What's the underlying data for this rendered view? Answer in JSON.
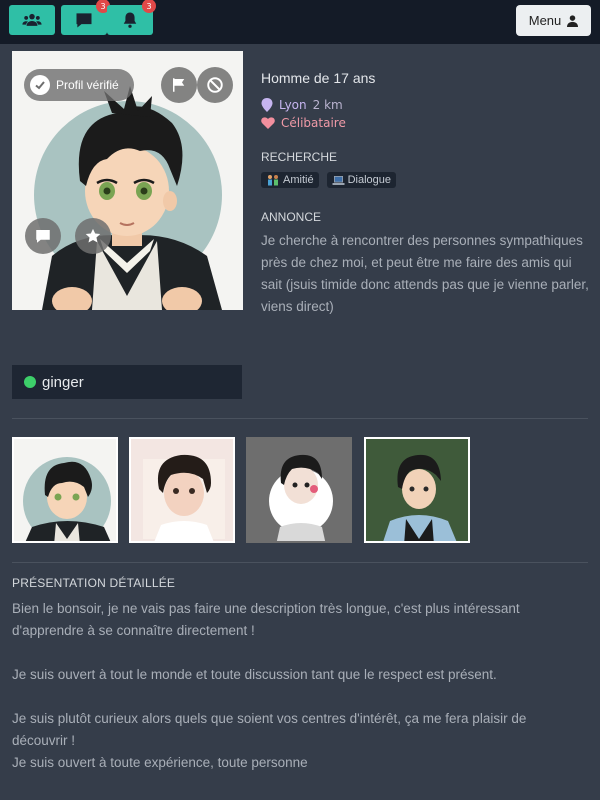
{
  "topbar": {
    "friends_icon": "users-icon",
    "messages_icon": "chat-icon",
    "messages_badge": "3",
    "notifications_icon": "bell-icon",
    "notifications_badge": "3",
    "menu_label": "Menu"
  },
  "profile": {
    "verified_label": "Profil vérifié",
    "title": "Homme de 17 ans",
    "city": "Lyon",
    "distance": "2 km",
    "status": "Célibataire",
    "search_heading": "RECHERCHE",
    "search_tags": [
      "Amitié",
      "Dialogue"
    ],
    "annonce_heading": "ANNONCE",
    "annonce_text": "Je cherche à rencontrer des personnes sympathiques près de chez moi, et peut être me faire des amis qui sait (jsuis timide donc attends pas que je vienne parler, viens direct)",
    "username": "ginger",
    "online": true
  },
  "presentation": {
    "heading": "PRÉSENTATION DÉTAILLÉE",
    "text": "Bien le bonsoir, je ne vais pas faire une description très longue, c'est plus intéressant d'apprendre à se connaître directement !\n\nJe suis ouvert à tout le monde et toute discussion tant que le respect est présent.\n\nJe suis plutôt curieux alors quels que soient vos centres d'intérêt, ça me fera plaisir de découvrir !\nJe suis ouvert à toute expérience, toute personne"
  },
  "colors": {
    "accent": "#2fbfa6",
    "background": "#353d4a",
    "topbar": "#141b27",
    "online": "#3dcf6a",
    "badge": "#e04848"
  }
}
